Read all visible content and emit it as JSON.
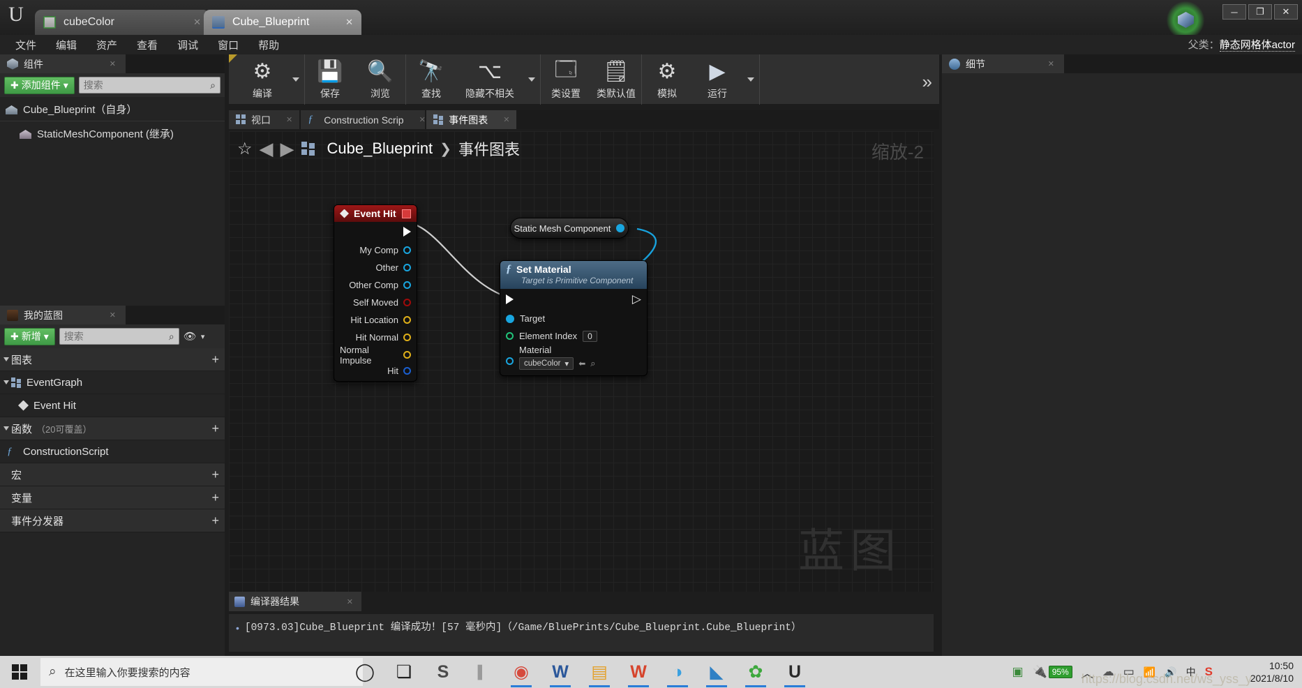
{
  "window": {
    "tabs": [
      {
        "label": "cubeColor",
        "icon": "asset-icon",
        "active": false
      },
      {
        "label": "Cube_Blueprint",
        "icon": "blueprint-icon",
        "active": true
      }
    ],
    "close_glyph": "✕",
    "controls": {
      "minimize": "─",
      "maximize": "❐",
      "close": "✕"
    }
  },
  "menubar": {
    "items": [
      "文件",
      "编辑",
      "资产",
      "查看",
      "调试",
      "窗口",
      "帮助"
    ]
  },
  "parent_class": {
    "label": "父类：",
    "value": "静态网格体actor"
  },
  "components_panel": {
    "tab_label": "组件",
    "add_button": "添加组件",
    "add_caret": "▾",
    "search_placeholder": "搜索",
    "search_glyph": "⌕",
    "items": [
      {
        "label": "Cube_Blueprint（自身）",
        "indent": 0
      },
      {
        "label": "StaticMeshComponent (继承)",
        "indent": 1
      }
    ]
  },
  "myblueprint_panel": {
    "tab_label": "我的蓝图",
    "add_button": "新增",
    "add_caret": "▾",
    "search_placeholder": "搜索",
    "search_glyph": "⌕",
    "eye_glyph": "👁",
    "eye_caret": "▾",
    "sections": [
      {
        "label": "图表",
        "note": "",
        "plus": "+",
        "type": "section"
      },
      {
        "label": "EventGraph",
        "note": "",
        "type": "graph"
      },
      {
        "label": "Event Hit",
        "note": "",
        "type": "event"
      },
      {
        "label": "函数",
        "note": "（20可覆盖）",
        "plus": "+",
        "type": "section"
      },
      {
        "label": "ConstructionScript",
        "note": "",
        "type": "function"
      },
      {
        "label": "宏",
        "note": "",
        "plus": "+",
        "type": "section"
      },
      {
        "label": "变量",
        "note": "",
        "plus": "+",
        "type": "section"
      },
      {
        "label": "事件分发器",
        "note": "",
        "plus": "+",
        "type": "section"
      }
    ]
  },
  "toolbar": {
    "buttons": [
      {
        "label": "编译",
        "icon": "compile-icon",
        "caret": true
      },
      {
        "label": "保存",
        "icon": "save-icon",
        "caret": false
      },
      {
        "label": "浏览",
        "icon": "browse-icon",
        "caret": false
      },
      {
        "label": "查找",
        "icon": "find-icon",
        "caret": false
      },
      {
        "label": "隐藏不相关",
        "icon": "hide-unrelated-icon",
        "caret": true
      },
      {
        "label": "类设置",
        "icon": "class-settings-icon",
        "caret": false
      },
      {
        "label": "类默认值",
        "icon": "class-defaults-icon",
        "caret": false
      },
      {
        "label": "模拟",
        "icon": "simulate-icon",
        "caret": false
      },
      {
        "label": "运行",
        "icon": "play-icon",
        "caret": true
      }
    ],
    "overflow_glyph": "»"
  },
  "graph_tabs": [
    {
      "label": "视口",
      "icon": "viewport-icon",
      "active": false
    },
    {
      "label": "Construction Scrip",
      "icon": "function-icon",
      "active": false
    },
    {
      "label": "事件图表",
      "icon": "eventgraph-icon",
      "active": true
    }
  ],
  "breadcrumb": {
    "star_glyph": "☆",
    "back_glyph": "◀",
    "forward_glyph": "▶",
    "root": "Cube_Blueprint",
    "separator": "❯",
    "current": "事件图表"
  },
  "canvas": {
    "zoom_label": "缩放-2",
    "watermark": "蓝图"
  },
  "nodes": {
    "event_hit": {
      "title": "Event Hit",
      "title_color": "#8c1111",
      "badge": "stop-badge",
      "pins": [
        {
          "label": "",
          "type": "exec"
        },
        {
          "label": "My Comp",
          "type": "object",
          "color": "#19a6e0"
        },
        {
          "label": "Other",
          "type": "object",
          "color": "#19a6e0"
        },
        {
          "label": "Other Comp",
          "type": "object",
          "color": "#19a6e0"
        },
        {
          "label": "Self Moved",
          "type": "bool",
          "color": "#a00a0a"
        },
        {
          "label": "Hit Location",
          "type": "vector",
          "color": "#e0b019"
        },
        {
          "label": "Hit Normal",
          "type": "vector",
          "color": "#e0b019"
        },
        {
          "label": "Normal Impulse",
          "type": "vector",
          "color": "#e0b019"
        },
        {
          "label": "Hit",
          "type": "struct",
          "color": "#1a5fd0"
        }
      ]
    },
    "static_mesh_component": {
      "title": "Static Mesh Component",
      "pin_color": "#19a6e0"
    },
    "set_material": {
      "title": "Set Material",
      "subtitle": "Target is Primitive Component",
      "fn_glyph": "ƒ",
      "inputs": [
        {
          "label": "Target",
          "type": "object",
          "color": "#19a6e0",
          "filled": true
        },
        {
          "label": "Element Index",
          "type": "int",
          "color": "#21c47a",
          "value": "0"
        },
        {
          "label": "Material",
          "type": "object",
          "color": "#19a6e0",
          "value": "cubeColor",
          "caret": "▾",
          "arrow_glyph": "⬅",
          "find_glyph": "⌕"
        }
      ]
    }
  },
  "compiler_results": {
    "tab_label": "编译器结果",
    "bullet": "•",
    "message": "[0973.03]Cube_Blueprint 编译成功！[57 毫秒内]（/Game/BluePrints/Cube_Blueprint.Cube_Blueprint）"
  },
  "details_panel": {
    "tab_label": "细节",
    "icon": "info-icon"
  },
  "taskbar": {
    "search_placeholder": "在这里输入你要搜索的内容",
    "search_glyph": "⌕",
    "apps": [
      {
        "name": "cortana-icon",
        "glyph": "◯",
        "active": false
      },
      {
        "name": "task-view-icon",
        "glyph": "❏",
        "active": false
      },
      {
        "name": "app-s-icon",
        "glyph": "S",
        "active": false
      },
      {
        "name": "divider",
        "glyph": "▌",
        "active": false
      },
      {
        "name": "chrome-icon",
        "glyph": "◉",
        "active": true
      },
      {
        "name": "word-icon",
        "glyph": "W",
        "active": true
      },
      {
        "name": "explorer-icon",
        "glyph": "▤",
        "active": true
      },
      {
        "name": "wps-icon",
        "glyph": "W",
        "active": true
      },
      {
        "name": "qq-icon",
        "glyph": "◑",
        "active": true
      },
      {
        "name": "vscode-icon",
        "glyph": "◣",
        "active": true
      },
      {
        "name": "wechat-icon",
        "glyph": "✿",
        "active": true
      },
      {
        "name": "unreal-icon",
        "glyph": "U",
        "active": true
      }
    ],
    "tray": {
      "usb_glyph": "▣",
      "battery_percent": "95%",
      "chevron_glyph": "︿",
      "cloud_glyph": "☁",
      "battery2_glyph": "▭",
      "wifi_glyph": "📶",
      "volume_glyph": "🔊",
      "ime_glyph": "中",
      "sogou_glyph": "S"
    },
    "clock_time": "10:50",
    "clock_date": "2021/8/10",
    "watermark": "https://blog.csdn.net/ws_yss_y"
  }
}
